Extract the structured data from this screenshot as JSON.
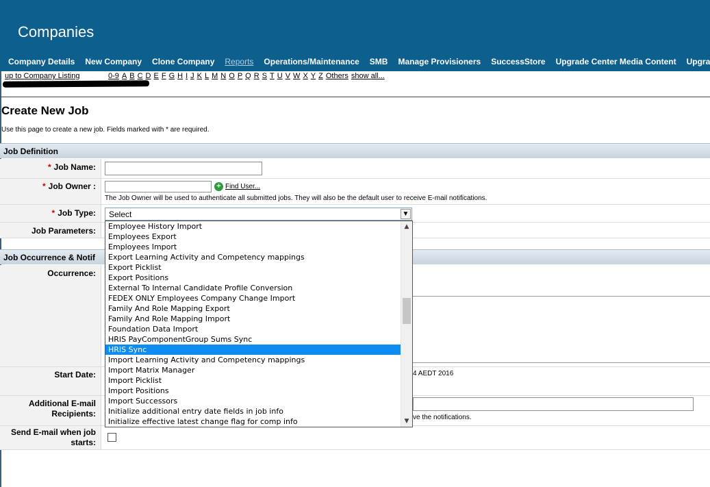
{
  "header": {
    "title": "Companies",
    "nav": [
      {
        "label": "Company Details",
        "muted": false
      },
      {
        "label": "New Company",
        "muted": false
      },
      {
        "label": "Clone Company",
        "muted": false
      },
      {
        "label": "Reports",
        "muted": true
      },
      {
        "label": "Operations/Maintenance",
        "muted": false
      },
      {
        "label": "SMB",
        "muted": false
      },
      {
        "label": "Manage Provisioners",
        "muted": false
      },
      {
        "label": "SuccessStore",
        "muted": false
      },
      {
        "label": "Upgrade Center Media Content",
        "muted": false
      },
      {
        "label": "Upgrade Cen",
        "muted": false
      }
    ]
  },
  "subnav": {
    "up_link": "up to Company Listing",
    "letters": [
      "0-9",
      "A",
      "B",
      "C",
      "D",
      "E",
      "F",
      "G",
      "H",
      "I",
      "J",
      "K",
      "L",
      "M",
      "N",
      "O",
      "P",
      "Q",
      "R",
      "S",
      "T",
      "U",
      "V",
      "W",
      "X",
      "Y",
      "Z",
      "Others",
      "show all..."
    ]
  },
  "page": {
    "title": "Create New Job",
    "intro": "Use this page to create a new job. Fields marked with * are required."
  },
  "job_definition": {
    "section_title": "Job Definition",
    "required_marker": "*",
    "job_name_label": "Job Name:",
    "job_owner_label": "Job Owner :",
    "find_user": "Find User...",
    "owner_help": "The Job Owner will be used to authenticate all submitted jobs. They will also be the default user to receive E-mail notifications.",
    "job_type_label": "Job Type:",
    "job_type_value": "Select",
    "job_params_label": "Job Parameters:"
  },
  "job_type_options": [
    "Employee History Import",
    "Employees Export",
    "Employees Import",
    "Export Learning Activity and Competency mappings",
    "Export Picklist",
    "Export Positions",
    "External To Internal Candidate Profile Conversion",
    "FEDEX ONLY Employees Company Change Import",
    "Family And Role Mapping Export",
    "Family And Role Mapping Import",
    "Foundation Data Import",
    "HRIS PayComponentGroup Sums Sync",
    "HRIS Sync",
    "Import Learning Activity and Competency mappings",
    "Import Matrix Manager",
    "Import Picklist",
    "Import Positions",
    "Import Successors",
    "Initialize additional entry date fields in job info",
    "Initialize effective latest change flag for comp info"
  ],
  "job_type_selected": "HRIS Sync",
  "occurrence": {
    "section_title": "Job Occurrence & Notif",
    "occurrence_label": "Occurrence:",
    "start_date_label": "Start Date:",
    "start_date_fragment": "4 AEDT 2016",
    "recipients_label": "Additional E-mail Recipients:",
    "recipients_fragment": "ve the notifications.",
    "send_email_label": "Send E-mail when job starts:"
  }
}
